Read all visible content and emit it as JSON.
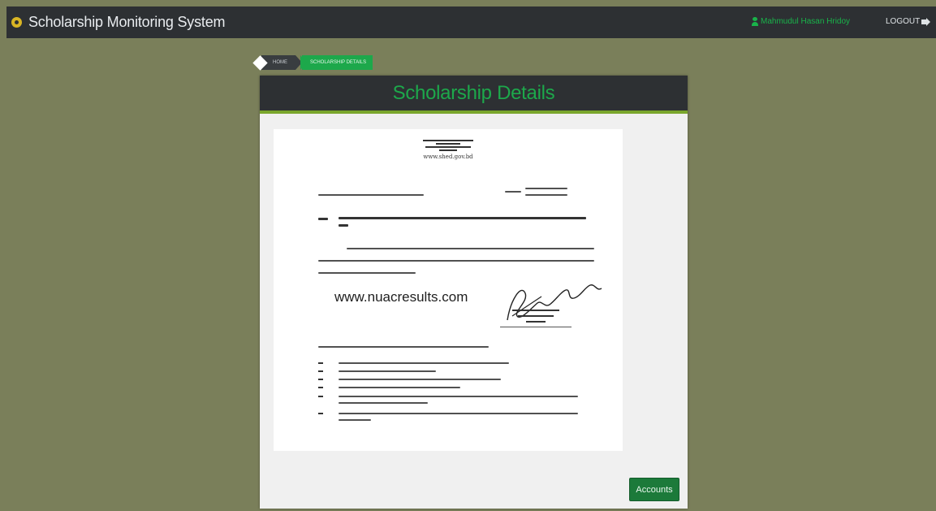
{
  "app": {
    "title": "Scholarship Monitoring System",
    "user_name": "Mahmudul Hasan Hridoy",
    "logout_label": "LOGOUT"
  },
  "breadcrumb": {
    "home": "HOME",
    "current": "SCHOLARSHIP DETAILS"
  },
  "card": {
    "title": "Scholarship Details",
    "document": {
      "website": "www.shed.gov.bd",
      "watermark": "www.nuacresults.com"
    },
    "accounts_button": "Accounts"
  },
  "colors": {
    "background": "#7a7f5a",
    "navbar": "#2d3033",
    "accent_green": "#1da84b",
    "button_green": "#1c7a3a"
  }
}
